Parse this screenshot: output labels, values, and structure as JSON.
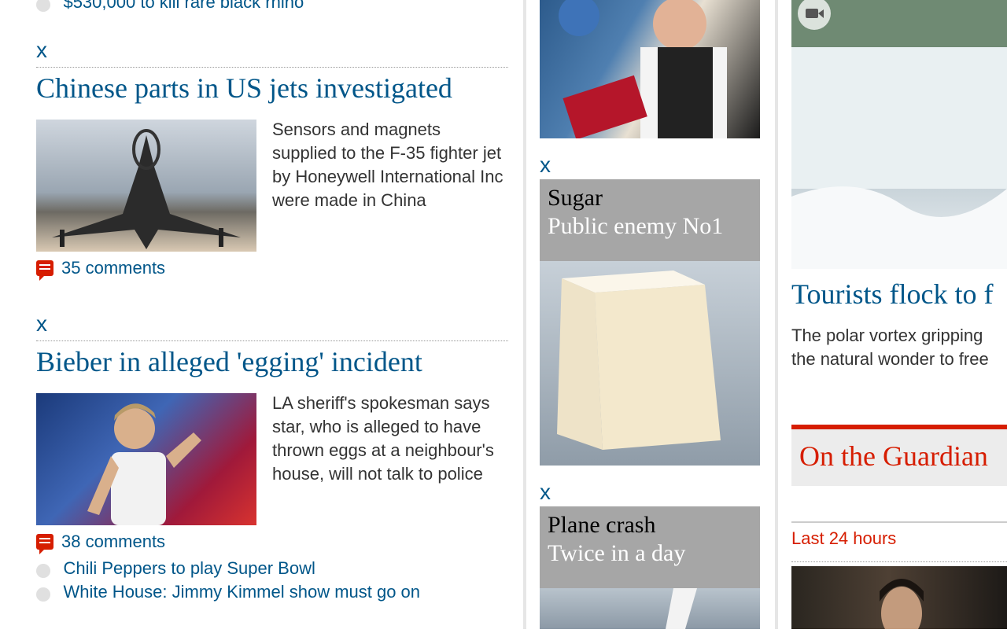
{
  "left": {
    "top_partial_link": "$530,000 to kill rare black rhino",
    "close_label": "x",
    "story1": {
      "headline": "Chinese parts in US jets investigated",
      "summary": "Sensors and magnets supplied to the F-35 fighter jet by Honeywell International Inc were made in China",
      "comments": "35 comments"
    },
    "story2": {
      "headline": "Bieber in alleged 'egging' incident",
      "summary": "LA sheriff's spokesman says star, who is alleged to have thrown eggs at a neighbour's house, will not talk to police",
      "comments": "38 comments"
    },
    "links": [
      "Chili Peppers to play Super Bowl",
      "White House: Jimmy Kimmel show must go on"
    ]
  },
  "middle": {
    "close_label": "x",
    "promo1": {
      "title": "Sugar",
      "subtitle": "Public enemy No1"
    },
    "promo2": {
      "title": "Plane crash",
      "subtitle": "Twice in a day"
    }
  },
  "right": {
    "video_icon": "video-camera-icon",
    "headline": "Tourists flock to f",
    "summary_line1": "The polar vortex gripping",
    "summary_line2": "the natural wonder to free",
    "section_title": "On the Guardian",
    "tab_label": "Last 24 hours"
  },
  "colors": {
    "link_blue": "#005689",
    "guardian_red": "#d61d00",
    "promo_gray": "#a6a6a6"
  }
}
